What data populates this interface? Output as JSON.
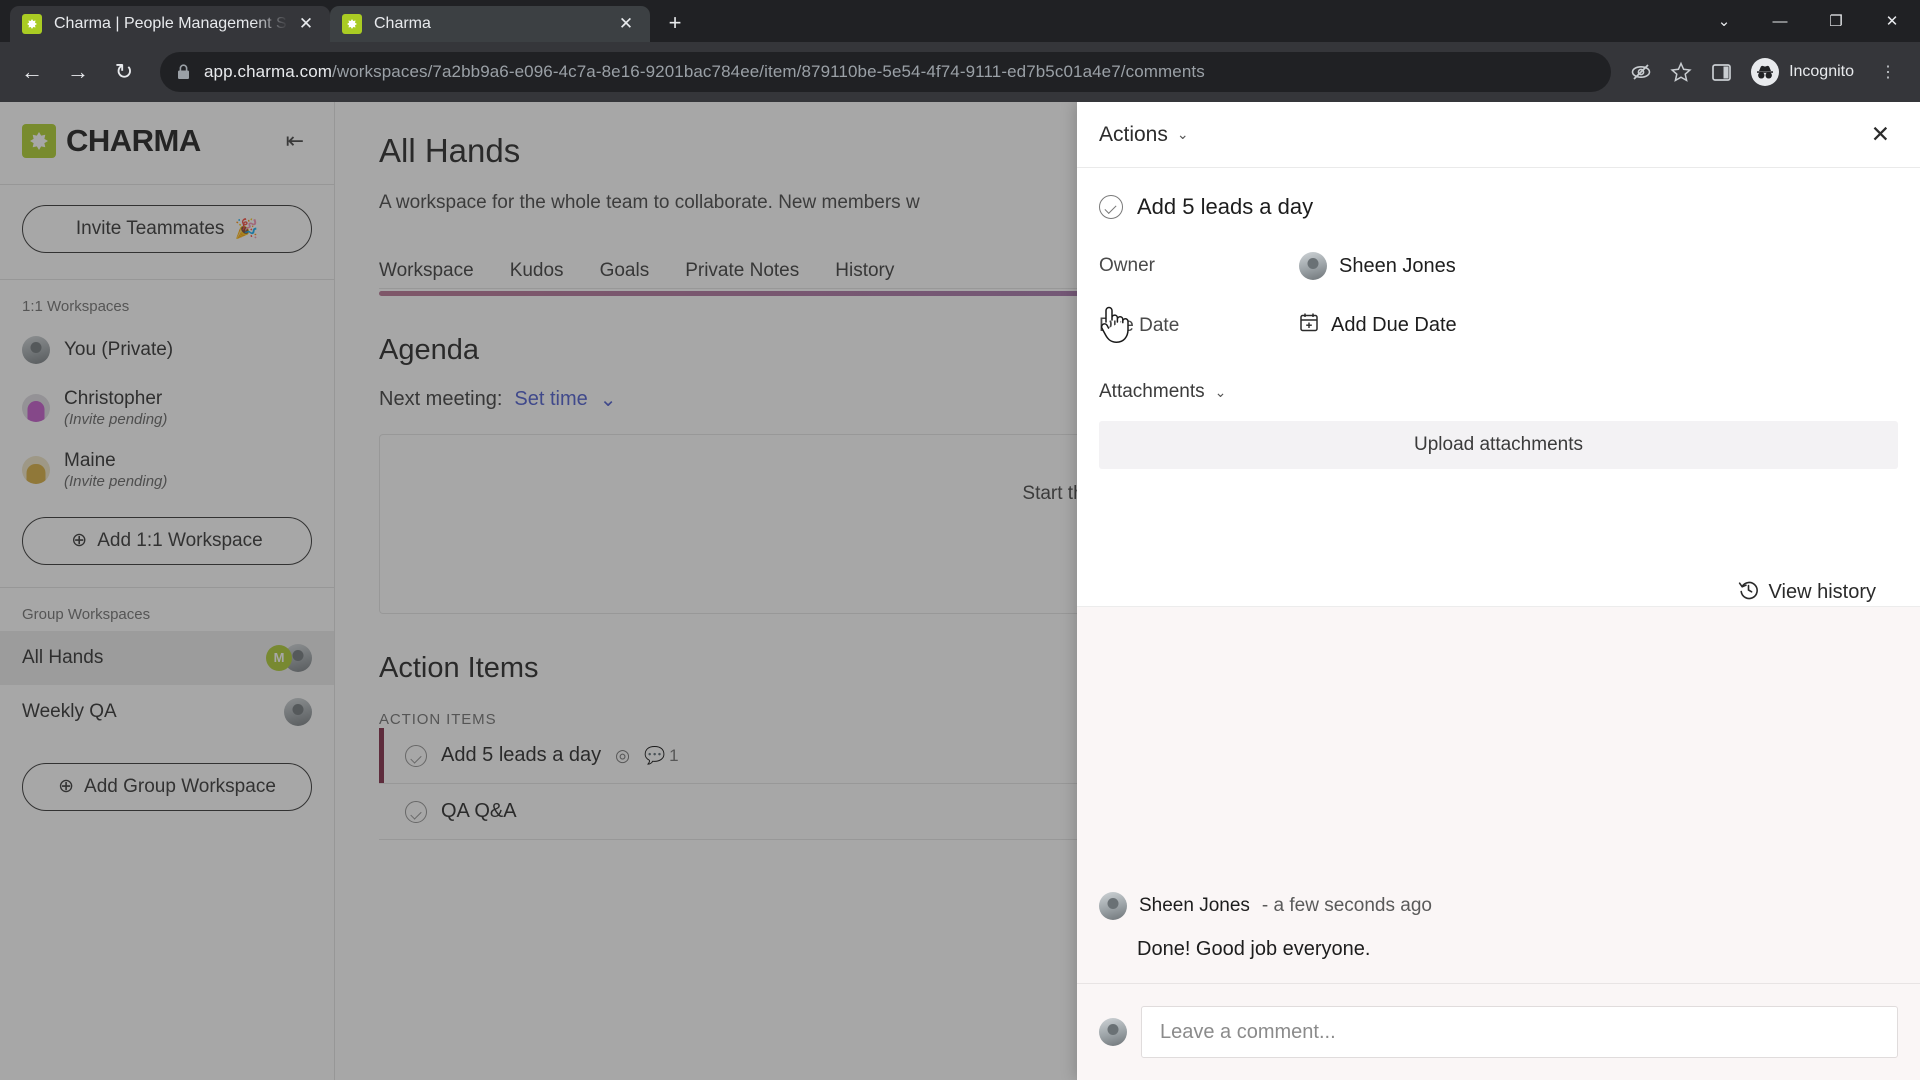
{
  "browser": {
    "tabs": [
      {
        "title": "Charma | People Management S",
        "favicon": "charma-icon",
        "active": false
      },
      {
        "title": "Charma",
        "favicon": "charma-icon",
        "active": true
      }
    ],
    "new_tab_label": "+",
    "window_controls": [
      {
        "name": "tab-search",
        "glyph": "⌄"
      },
      {
        "name": "minimize",
        "glyph": "—"
      },
      {
        "name": "maximize",
        "glyph": "❐"
      },
      {
        "name": "close",
        "glyph": "✕"
      }
    ],
    "nav": {
      "back": "←",
      "forward": "→",
      "reload": "↻"
    },
    "url_host": "app.charma.com",
    "url_path": "/workspaces/7a2bb9a6-e096-4c7a-8e16-9201bac784ee/item/879110be-5e54-4f74-9111-ed7b5c01a4e7/comments",
    "toolbar_icons": [
      {
        "name": "tracking-protection-icon",
        "glyph": "⊘"
      },
      {
        "name": "bookmark-star-icon",
        "glyph": "☆"
      },
      {
        "name": "side-panel-icon",
        "glyph": "▧"
      }
    ],
    "profile_label": "Incognito",
    "menu_glyph": "⋮"
  },
  "sidebar": {
    "brand": "CHARMA",
    "collapse_glyph": "⇤",
    "invite_button": "Invite Teammates",
    "invite_emoji": "🎉",
    "section_one_one": "1:1 Workspaces",
    "one_one_items": [
      {
        "name": "You (Private)",
        "sub": "",
        "avatar": "photo"
      },
      {
        "name": "Christopher",
        "sub": "(Invite pending)",
        "avatar": "purple"
      },
      {
        "name": "Maine",
        "sub": "(Invite pending)",
        "avatar": "gold"
      }
    ],
    "add_one_one_button": "Add 1:1 Workspace",
    "section_group": "Group Workspaces",
    "group_items": [
      {
        "name": "All Hands",
        "badge": "M",
        "active": true
      },
      {
        "name": "Weekly QA",
        "badge": "",
        "active": false
      }
    ],
    "add_group_button": "Add Group Workspace",
    "add_glyph": "⊕"
  },
  "main": {
    "title": "All Hands",
    "description": "A workspace for the whole team to collaborate. New members w",
    "tabs": [
      "Workspace",
      "Kudos",
      "Goals",
      "Private Notes",
      "History"
    ],
    "agenda_heading": "Agenda",
    "next_meeting_label": "Next meeting:",
    "set_time_link": "Set time",
    "agenda_empty_text": "Start the collaborative ag",
    "agenda_plus": "+",
    "action_items_heading": "Action Items",
    "action_items_label": "ACTION ITEMS",
    "action_items": [
      {
        "text": "Add 5 leads a day",
        "comment_count": "1",
        "selected": true
      },
      {
        "text": "QA Q&A",
        "comment_count": "",
        "selected": false
      }
    ]
  },
  "panel": {
    "actions_label": "Actions",
    "caret_glyph": "⌄",
    "close_glyph": "✕",
    "task_title": "Add 5 leads a day",
    "owner_label": "Owner",
    "owner_name": "Sheen Jones",
    "due_date_label": "Due Date",
    "due_date_value": "Add Due Date",
    "calendar_glyph": "Ὄ5",
    "attachments_label": "Attachments",
    "upload_label": "Upload attachments",
    "view_history_label": "View history",
    "history_glyph": "↺",
    "comments": [
      {
        "author": "Sheen Jones",
        "time": "- a few seconds ago",
        "body": "Done! Good job everyone."
      }
    ],
    "composer_placeholder": "Leave a comment..."
  },
  "colors": {
    "brand_green": "#aacc23",
    "tab_accent": "#8b6fc4",
    "selected_bar": "#7a1f3d",
    "comments_bg": "#faf6f6"
  }
}
